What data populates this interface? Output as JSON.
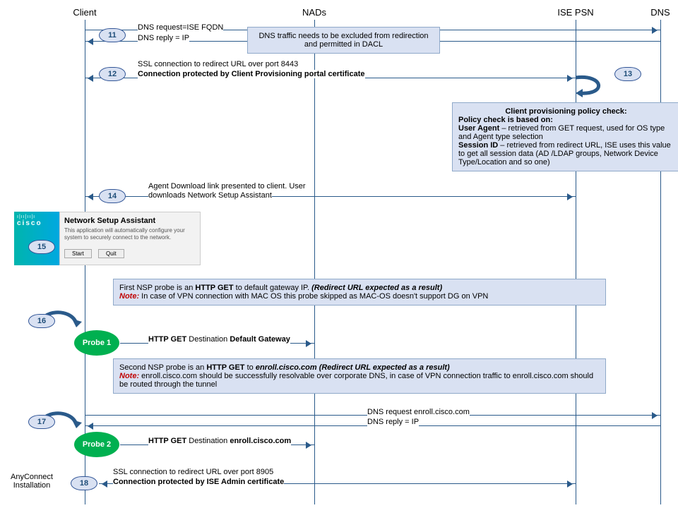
{
  "actors": {
    "client": "Client",
    "nads": "NADs",
    "ise": "ISE PSN",
    "dns": "DNS"
  },
  "steps": {
    "s11": "11",
    "s12": "12",
    "s13": "13",
    "s14": "14",
    "s15": "15",
    "s16": "16",
    "s17": "17",
    "s18": "18"
  },
  "msg11a": "DNS request=ISE FQDN",
  "msg11b": "DNS reply = IP",
  "note_dns": "DNS traffic needs to be excluded from redirection and permitted  in DACL",
  "msg12a": "SSL connection to redirect URL over port 8443",
  "msg12b": "Connection  protected  by Client Provisioning  portal certificate",
  "note13_title": "Client provisioning policy check:",
  "note13_l1": "Policy check is based on:",
  "note13_l2a": "User Agent",
  "note13_l2b": " – retrieved from GET request, used for OS type and Agent type  selection",
  "note13_l3a": "Session ID",
  "note13_l3b": " – retrieved from redirect URL, ISE uses this value to get  all session data (AD /LDAP  groups, Network Device Type/Location and so one)",
  "msg14a": "Agent Download link presented to client. User",
  "msg14b": "downloads Network Setup Assistant",
  "cisco": "cisco",
  "nsa_title": "Network Setup Assistant",
  "nsa_desc": "This application will automatically configure your system to securely connect to the network.",
  "nsa_start": "Start",
  "nsa_quit": "Quit",
  "note16_l1a": "First NSP probe is an ",
  "note16_l1b": "HTTP GET",
  "note16_l1c": " to default gateway IP. ",
  "note16_l1d": "(Redirect URL expected  as a result)",
  "note16_l2a": "Note:",
  "note16_l2b": " In case of VPN connection with MAC OS this probe skipped as MAC-OS  doesn't support DG on VPN",
  "probe1": "Probe 1",
  "msg_p1a": "HTTP GET ",
  "msg_p1b": "Destination ",
  "msg_p1c": "Default Gateway",
  "note17_l1a": "Second NSP probe is an ",
  "note17_l1b": "HTTP  GET",
  "note17_l1c": " to ",
  "note17_l1d": "enroll.cisco.com  (Redirect  URL expected as a result)",
  "note17_l2a": "Note:",
  "note17_l2b": " enroll.cisco.com  should be successfully resolvable over corporate DNS,   in case of VPN connection traffic to enroll.cisco.com should be routed through the tunnel",
  "msg17a": "DNS request enroll.cisco.com",
  "msg17b": "DNS reply = IP",
  "probe2": "Probe 2",
  "msg_p2a": "HTTP GET ",
  "msg_p2b": "Destination ",
  "msg_p2c": "enroll.cisco.com",
  "msg18a": "SSL connection to redirect URL over port 8905",
  "msg18b": "Connection  protected by ISE Admin certificate",
  "side18": "AnyConnect Installation"
}
